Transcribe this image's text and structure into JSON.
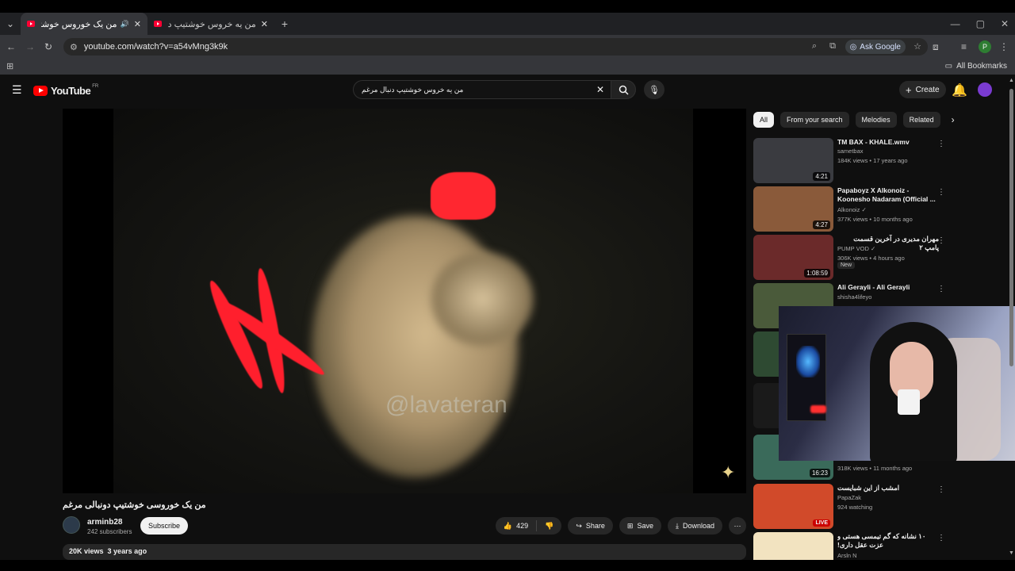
{
  "browser": {
    "tabs": [
      {
        "title": "من یک خوروس خوشتیپ دونـ",
        "active": true
      },
      {
        "title": "من یه خروس خوشتیپ دنبال مرغ",
        "active": false
      }
    ],
    "url": "youtube.com/watch?v=a54vMng3k9k",
    "ask_google": "Ask Google",
    "bookmarks_label": "All Bookmarks",
    "profile_initial": "P"
  },
  "youtube": {
    "logo_text": "YouTube",
    "region": "FR",
    "search_value": "من یه خروس خوشتیپ دنبال مرغم",
    "create_label": "Create"
  },
  "video": {
    "watermark": "@lavateran",
    "title": "من یک خوروسی خوشتیپ دونبالی مرغم",
    "channel": "arminb28",
    "subscribers": "242 subscribers",
    "subscribe_label": "Subscribe",
    "likes": "429",
    "share_label": "Share",
    "save_label": "Save",
    "download_label": "Download",
    "views": "20K views",
    "age": "3 years ago"
  },
  "chips": [
    "All",
    "From your search",
    "Melodies",
    "Related"
  ],
  "recommendations": [
    {
      "title": "TM BAX - KHALE.wmv",
      "channel": "sametbax",
      "meta": "184K views • 17 years ago",
      "duration": "4:21",
      "thumb": "#3a3b40"
    },
    {
      "title": "Papaboyz X Alkonoiz - Koonesho Nadaram (Official ...",
      "channel": "Alkonoiz",
      "meta": "377K views • 10 months ago",
      "duration": "4:27",
      "thumb": "#8a5a3a"
    },
    {
      "title": "مهران مدیری در آخرین قسمت پامپ ۲",
      "channel": "PUMP VOD",
      "meta": "306K views • 4 hours ago",
      "duration": "1:08:59",
      "badge": "New",
      "thumb": "#6b2a2a"
    },
    {
      "title": "Ali Gerayli - Ali Gerayli",
      "channel": "shisha4lifeyo",
      "meta": "",
      "duration": "",
      "thumb": "#4a5a3a"
    },
    {
      "title": "",
      "channel": "",
      "meta": "",
      "duration": "",
      "thumb": "#2e4a32"
    },
    {
      "title": "",
      "channel": "",
      "meta": "",
      "duration": "",
      "thumb": "#1a1a1a"
    },
    {
      "title": "",
      "channel": "",
      "meta": "318K views • 11 months ago",
      "duration": "16:23",
      "thumb": "#3a6a5a"
    },
    {
      "title": "امشب از این شبایست",
      "channel": "PapaZak",
      "meta": "924 watching",
      "live": "LIVE",
      "thumb": "#d14a2a"
    },
    {
      "title": "۱۰ نشانه که گم تیمسی هستی و عزت عقل داری!",
      "channel": "Arsln N",
      "meta": "",
      "duration": "",
      "thumb": "#f2e3c0"
    }
  ]
}
